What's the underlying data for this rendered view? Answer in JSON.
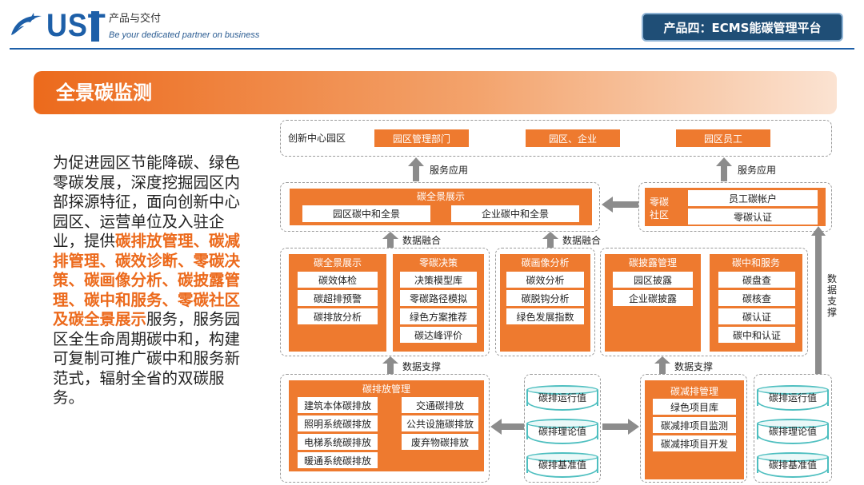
{
  "header": {
    "logo_text": "UST",
    "brand_cn": "产品与交付",
    "brand_en": "Be your dedicated partner on business",
    "product_tag": "产品四：ECMS能碳管理平台"
  },
  "section": {
    "title": "全景碳监测"
  },
  "description": {
    "part1": "为促进园区节能降碳、绿色零碳发展，深度挖掘园区内部探源特征，面向创新中心园区、运营单位及入驻企业，提供",
    "highlight": "碳排放管理、碳减排管理、碳效诊断、零碳决策、碳画像分析、碳披露管理、碳中和服务、零碳社区及碳全景展示",
    "part2": "服务，服务园区全生命周期碳中和，构建可复制可推广碳中和服务新范式，辐射全省的双碳服务。"
  },
  "diagram": {
    "top_row": {
      "label": "创新中心园区",
      "items": [
        "园区管理部门",
        "园区、企业",
        "园区员工"
      ]
    },
    "service_app_label": "服务应用",
    "panorama": {
      "title": "碳全景展示",
      "items": [
        "园区碳中和全景",
        "企业碳中和全景"
      ]
    },
    "zero_community": {
      "title": "零碳社区",
      "items": [
        "员工碳帐户",
        "零碳认证"
      ]
    },
    "data_fusion_label": "数据融合",
    "data_support_label": "数据支撑",
    "data_support_vertical": "数据支撑",
    "middle_modules": [
      {
        "title": "碳全景展示",
        "items": [
          "碳效体检",
          "碳超排预警",
          "碳排放分析"
        ]
      },
      {
        "title": "零碳决策",
        "items": [
          "决策模型库",
          "零碳路径模拟",
          "绿色方案推荐",
          "碳达峰评价"
        ]
      },
      {
        "title": "碳画像分析",
        "items": [
          "碳效分析",
          "碳脱钩分析",
          "绿色发展指数"
        ]
      },
      {
        "title": "碳披露管理",
        "items": [
          "园区披露",
          "企业碳披露"
        ]
      },
      {
        "title": "碳中和服务",
        "items": [
          "碳盘查",
          "碳核查",
          "碳认证",
          "碳中和认证"
        ]
      }
    ],
    "emission_mgmt": {
      "title": "碳排放管理",
      "left_items": [
        "建筑本体碳排放",
        "照明系统碳排放",
        "电梯系统碳排放",
        "暖通系统碳排放"
      ],
      "right_items": [
        "交通碳排放",
        "公共设施碳排放",
        "废弃物碳排放"
      ]
    },
    "reduction_mgmt": {
      "title": "碳减排管理",
      "items": [
        "绿色项目库",
        "碳减排项目监测",
        "碳减排项目开发"
      ]
    },
    "databases_left": [
      "碳排运行值",
      "碳排理论值",
      "碳排基准值"
    ],
    "databases_right": [
      "碳排运行值",
      "碳排理论值",
      "碳排基准值"
    ]
  },
  "colors": {
    "brand_blue": "#1d5fa8",
    "accent_orange": "#ee7a2f",
    "tag_navy": "#1f4e76",
    "arrow_gray": "#8c8c8c",
    "cylinder_teal": "#4fbfc0"
  }
}
